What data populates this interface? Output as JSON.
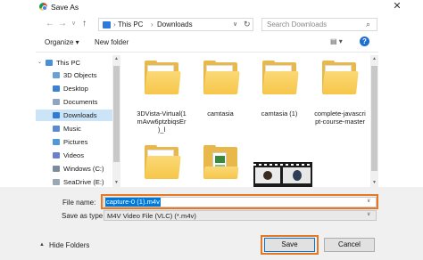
{
  "window": {
    "title": "Save As",
    "close_glyph": "✕"
  },
  "nav": {
    "back_glyph": "←",
    "forward_glyph": "→",
    "recent_glyph": "∨",
    "up_glyph": "↑",
    "path": [
      "This PC",
      "Downloads"
    ],
    "separator": "›",
    "dropdown_glyph": "∨",
    "refresh_glyph": "↻",
    "search_placeholder": "Search Downloads",
    "search_glyph": "⌕"
  },
  "toolbar": {
    "organize_label": "Organize ▾",
    "new_folder_label": "New folder",
    "view_glyph": "▤ ▾",
    "help_glyph": "?"
  },
  "sidebar": {
    "items": [
      {
        "label": "This PC",
        "icon": "monitor-icon",
        "color": "#4a8fd8"
      },
      {
        "label": "3D Objects",
        "icon": "3d-objects-icon",
        "color": "#6aa0d8"
      },
      {
        "label": "Desktop",
        "icon": "desktop-icon",
        "color": "#3b82d6"
      },
      {
        "label": "Documents",
        "icon": "documents-icon",
        "color": "#8fa6c0"
      },
      {
        "label": "Downloads",
        "icon": "downloads-icon",
        "color": "#2f7ad8",
        "selected": true
      },
      {
        "label": "Music",
        "icon": "music-icon",
        "color": "#5c8ad0"
      },
      {
        "label": "Pictures",
        "icon": "pictures-icon",
        "color": "#4f9ad6"
      },
      {
        "label": "Videos",
        "icon": "videos-icon",
        "color": "#6b7fd0"
      },
      {
        "label": "Windows (C:)",
        "icon": "drive-icon",
        "color": "#7a8b9c"
      },
      {
        "label": "SeaDrive (E:)",
        "icon": "drive-icon",
        "color": "#9aa7b4"
      }
    ]
  },
  "files": [
    {
      "name": "3DVista-Virtual(1\nmAvw6ptzbiqsEr\n)_l",
      "type": "folder"
    },
    {
      "name": "camtasia",
      "type": "folder"
    },
    {
      "name": "camtasia (1)",
      "type": "folder"
    },
    {
      "name": "complete-javascri\npt-course-master",
      "type": "folder"
    },
    {
      "name": "",
      "type": "folder"
    },
    {
      "name": "",
      "type": "folder"
    },
    {
      "name": "",
      "type": "video"
    }
  ],
  "form": {
    "file_name_label": "File name:",
    "file_name_value": "capture-0 (1).m4v",
    "save_as_type_label": "Save as type:",
    "save_as_type_value": "M4V Video File (VLC) (*.m4v)",
    "dropdown_glyph": "∨"
  },
  "footer": {
    "hide_folders_label": "Hide Folders",
    "hide_glyph": "▲",
    "save_label": "Save",
    "cancel_label": "Cancel"
  },
  "colors": {
    "highlight_orange": "#e87722",
    "selection_blue": "#0078d7",
    "sidebar_selected": "#cce4f7",
    "folder_yellow": "#f6c64a"
  }
}
